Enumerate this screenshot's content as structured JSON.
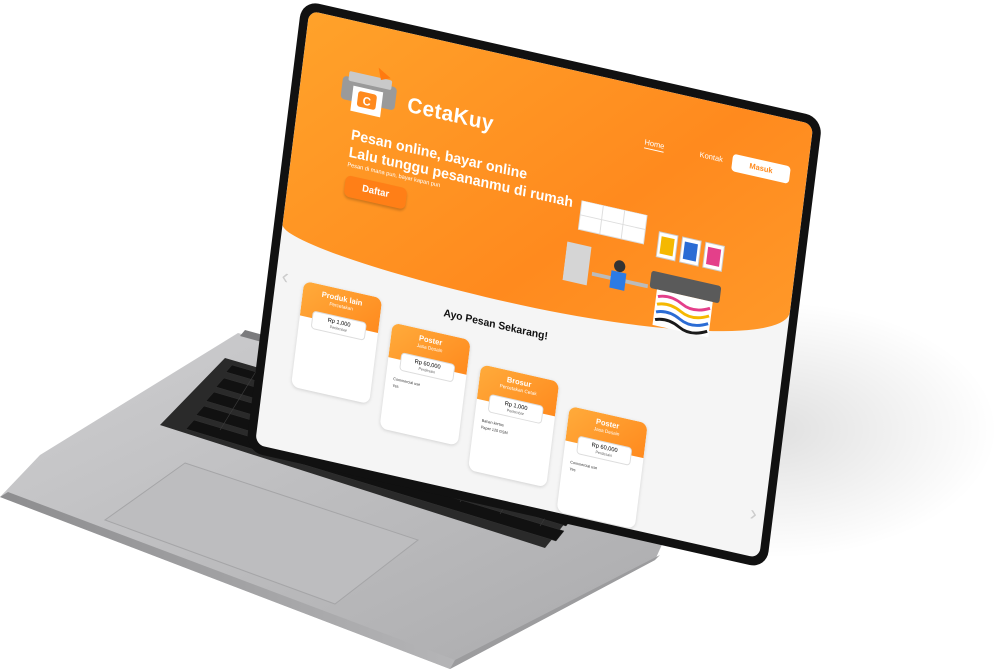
{
  "brand": {
    "name": "CetaKuy",
    "logo_letter": "C"
  },
  "nav": {
    "home": "Home",
    "contact": "Kontak",
    "login": "Masuk"
  },
  "hero": {
    "headline_1": "Pesan online, bayar online",
    "headline_2": "Lalu tunggu pesananmu di rumah",
    "subhead": "Pesan di mana pun, bayar kapan pun",
    "register": "Daftar"
  },
  "products": {
    "title": "Ayo Pesan Sekarang!",
    "cards": [
      {
        "name": "Produk lain",
        "sub": "Percetakan",
        "price": "Rp 1,000",
        "unit": "Perlembar",
        "line1": "",
        "line2": ""
      },
      {
        "name": "Poster",
        "sub": "Jasa Desain",
        "price": "Rp 60,000",
        "unit": "Perdesain",
        "line1": "Commercial use",
        "line2": "Yes"
      },
      {
        "name": "Brosur",
        "sub": "Percetakan Cetak",
        "price": "Rp 1,000",
        "unit": "Perlembar",
        "line1": "Bahan kertas",
        "line2": "Paper 120 GSM"
      },
      {
        "name": "Poster",
        "sub": "Jasa Desain",
        "price": "Rp 60,000",
        "unit": "Perdesain",
        "line1": "Commercial use",
        "line2": "Yes"
      }
    ]
  },
  "colors": {
    "accent": "#ff8a1e",
    "accent_light": "#ffa22a",
    "laptop_body": "#b9b9bb",
    "keyboard": "#1a1a1a"
  },
  "icons": {
    "prev": "chevron-left-icon",
    "next": "chevron-right-icon"
  }
}
